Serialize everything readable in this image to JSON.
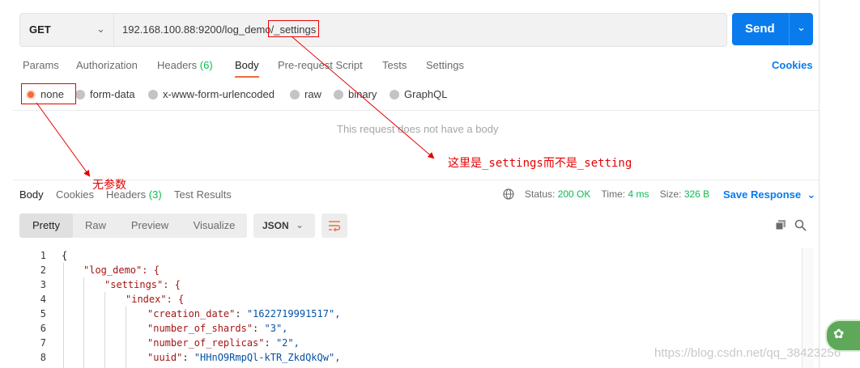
{
  "request": {
    "method": "GET",
    "url": "192.168.100.88:9200/log_demo/_settings",
    "send_label": "Send"
  },
  "request_tabs": [
    {
      "label": "Params"
    },
    {
      "label": "Authorization"
    },
    {
      "label": "Headers",
      "count": "(6)"
    },
    {
      "label": "Body"
    },
    {
      "label": "Pre-request Script"
    },
    {
      "label": "Tests"
    },
    {
      "label": "Settings"
    }
  ],
  "cookies_link": "Cookies",
  "body_types": [
    {
      "label": "none",
      "selected": true
    },
    {
      "label": "form-data"
    },
    {
      "label": "x-www-form-urlencoded"
    },
    {
      "label": "raw"
    },
    {
      "label": "binary"
    },
    {
      "label": "GraphQL"
    }
  ],
  "no_body_message": "This request does not have a body",
  "annotations": {
    "no_params": "无参数",
    "settings_note": "这里是_settings而不是_setting"
  },
  "response_tabs": [
    {
      "label": "Body"
    },
    {
      "label": "Cookies"
    },
    {
      "label": "Headers",
      "count": "(3)"
    },
    {
      "label": "Test Results"
    }
  ],
  "status": {
    "status_label": "Status:",
    "status_value": "200 OK",
    "time_label": "Time:",
    "time_value": "4 ms",
    "size_label": "Size:",
    "size_value": "326 B"
  },
  "save_response": "Save Response",
  "view_modes": [
    "Pretty",
    "Raw",
    "Preview",
    "Visualize"
  ],
  "format": "JSON",
  "code_lines": [
    {
      "n": "1",
      "text": "{"
    },
    {
      "n": "2",
      "text": "\"log_demo\": {"
    },
    {
      "n": "3",
      "text": "\"settings\": {"
    },
    {
      "n": "4",
      "text": "\"index\": {"
    },
    {
      "n": "5",
      "key": "\"creation_date\"",
      "value": "\"1622719991517\","
    },
    {
      "n": "6",
      "key": "\"number_of_shards\"",
      "value": "\"3\","
    },
    {
      "n": "7",
      "key": "\"number_of_replicas\"",
      "value": "\"2\","
    },
    {
      "n": "8",
      "key": "\"uuid\"",
      "value": "\"HHnO9RmpQl-kTR_ZkdQkQw\","
    }
  ],
  "watermark": "https://blog.csdn.net/qq_38423256",
  "colors": {
    "accent_blue": "#097bed",
    "active_orange": "#f26b3a",
    "ok_green": "#0cbb52",
    "annotation_red": "#e60000"
  }
}
